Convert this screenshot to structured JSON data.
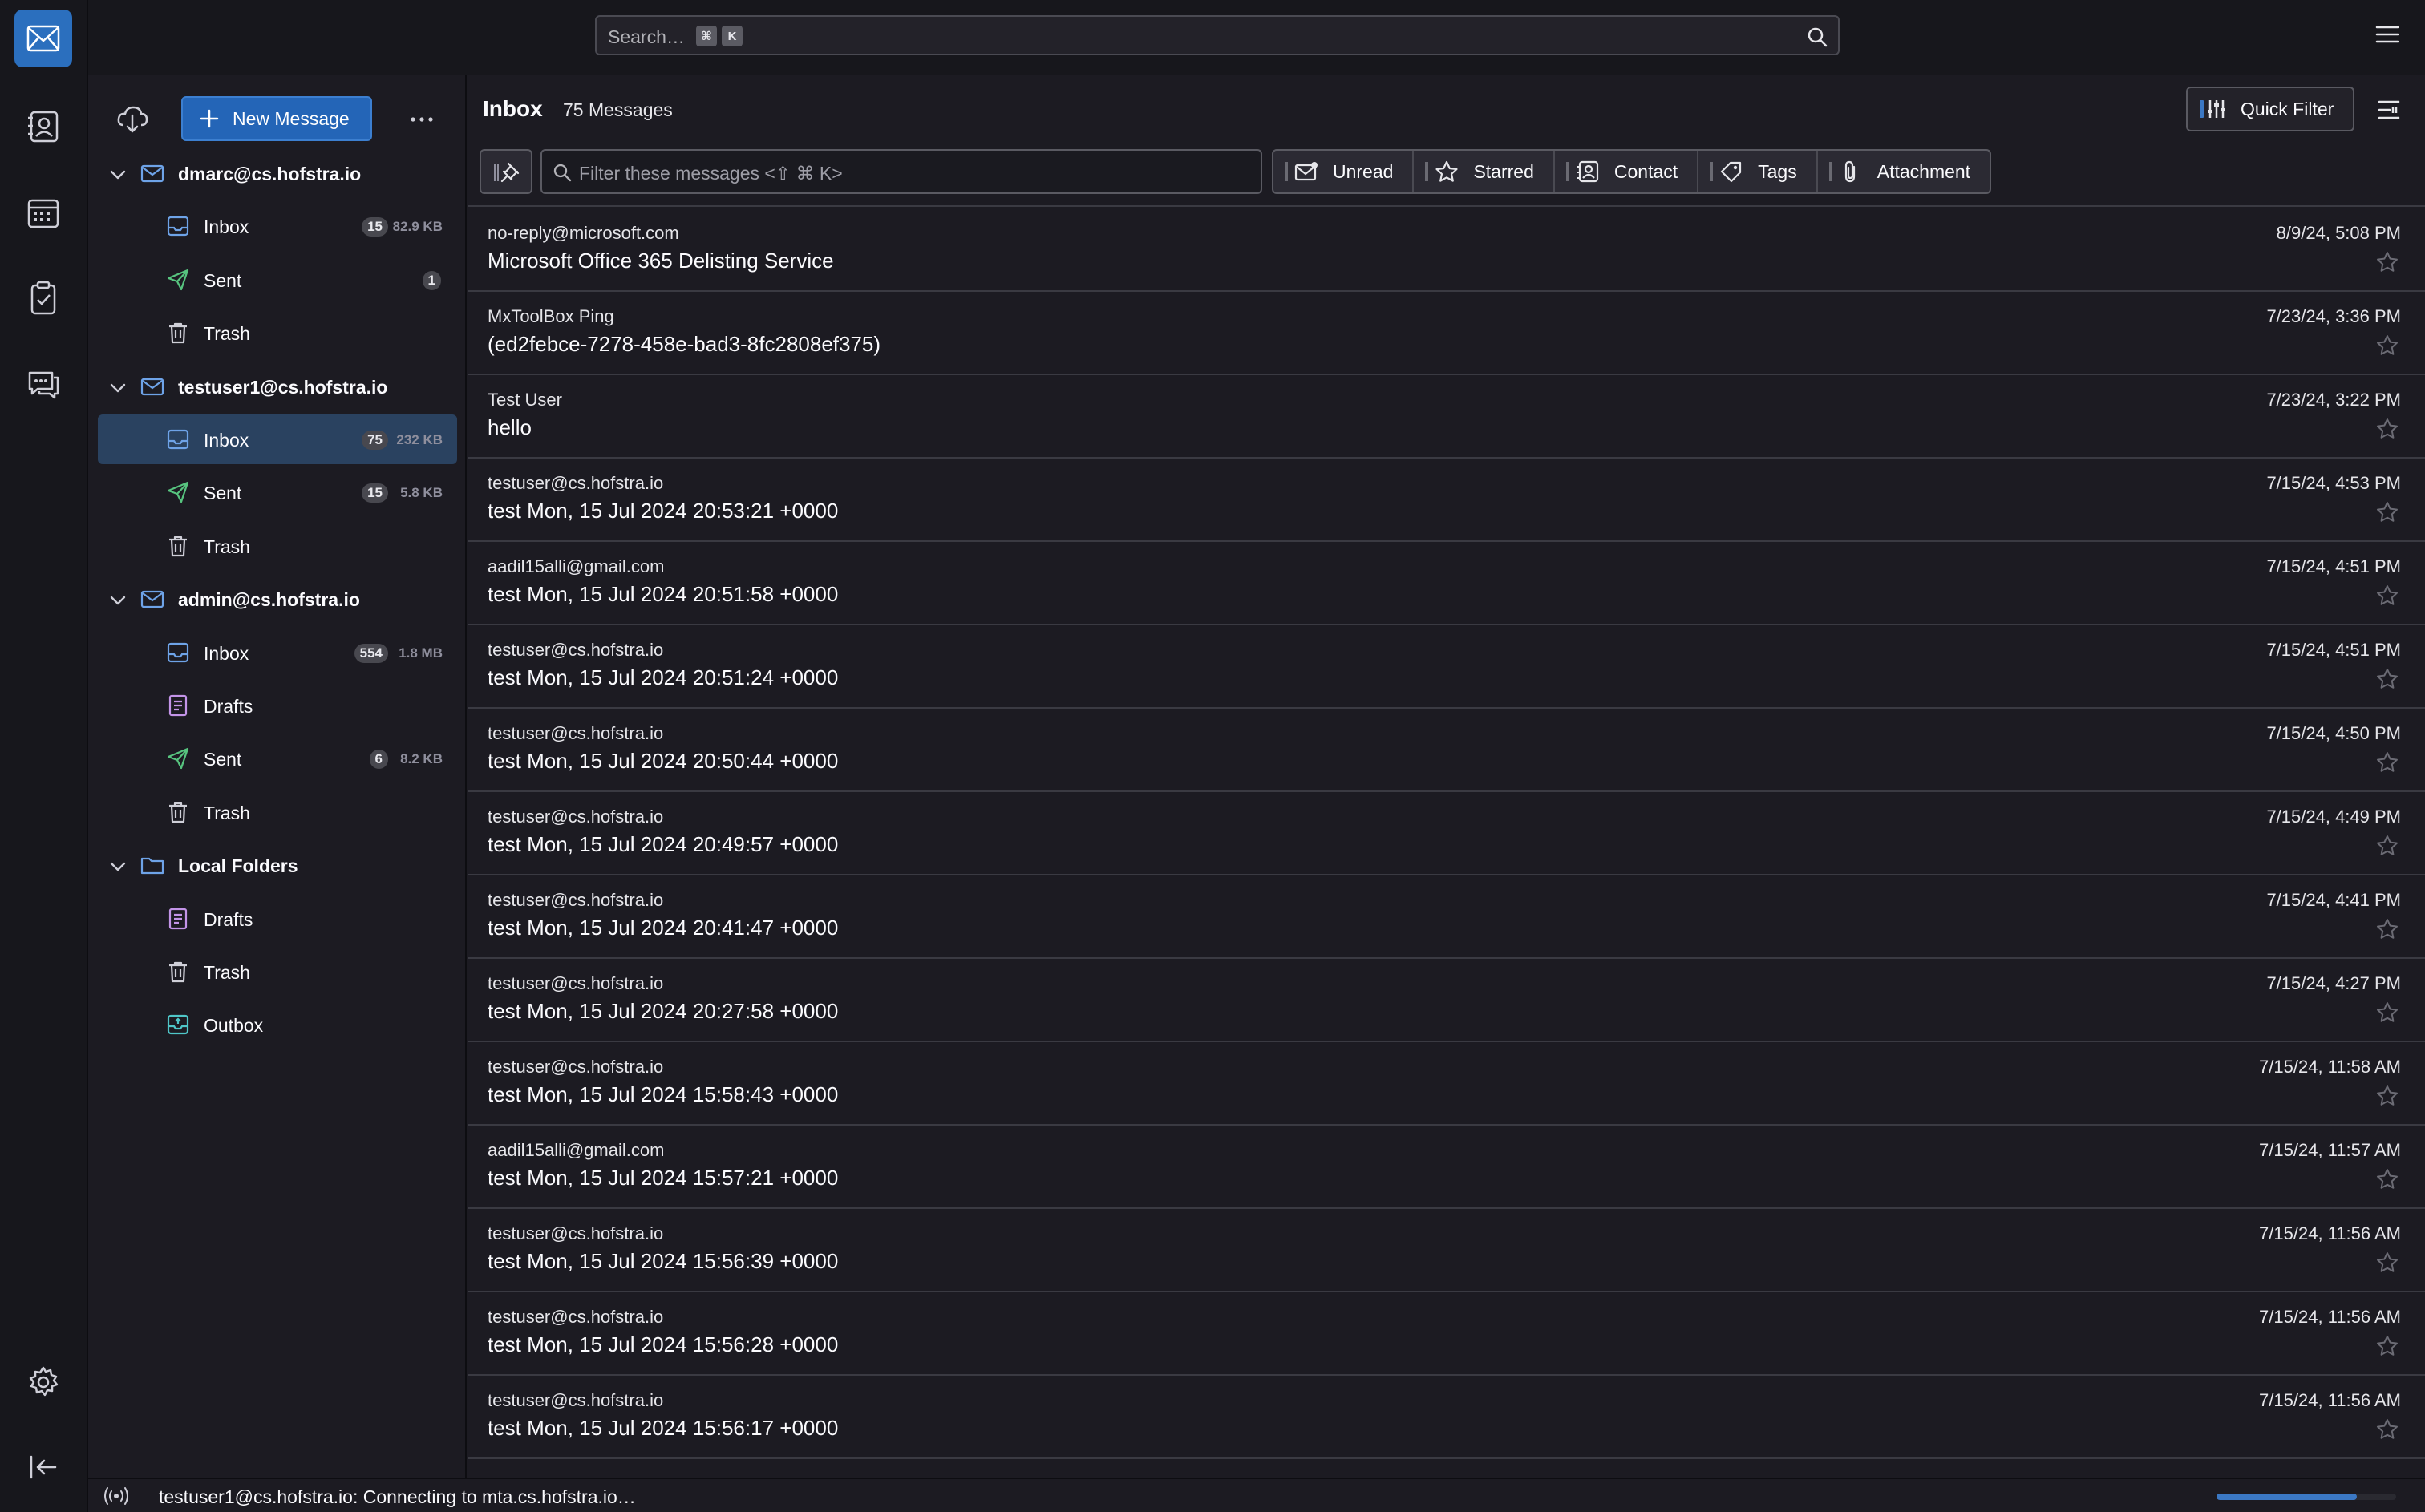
{
  "search": {
    "placeholder": "Search…",
    "shortcut_keys": [
      "⌘",
      "K"
    ]
  },
  "spaces": {
    "items": [
      "mail-icon",
      "address-book-icon",
      "calendar-icon",
      "tasks-icon",
      "chat-icon"
    ],
    "bottom": [
      "settings-icon",
      "collapse-icon"
    ]
  },
  "folder_pane": {
    "new_message_label": "New Message",
    "accounts": [
      {
        "label": "dmarc@cs.hofstra.io",
        "folders": [
          {
            "label": "Inbox",
            "badge": "15",
            "size": "82.9 KB",
            "icon": "inbox-icon"
          },
          {
            "label": "Sent",
            "badge": "1",
            "size": "",
            "icon": "sent-icon"
          },
          {
            "label": "Trash",
            "badge": "",
            "size": "",
            "icon": "trash-icon"
          }
        ]
      },
      {
        "label": "testuser1@cs.hofstra.io",
        "folders": [
          {
            "label": "Inbox",
            "badge": "75",
            "size": "232 KB",
            "icon": "inbox-icon",
            "selected": true
          },
          {
            "label": "Sent",
            "badge": "15",
            "size": "5.8 KB",
            "icon": "sent-icon"
          },
          {
            "label": "Trash",
            "badge": "",
            "size": "",
            "icon": "trash-icon"
          }
        ]
      },
      {
        "label": "admin@cs.hofstra.io",
        "folders": [
          {
            "label": "Inbox",
            "badge": "554",
            "size": "1.8 MB",
            "icon": "inbox-icon"
          },
          {
            "label": "Drafts",
            "badge": "",
            "size": "",
            "icon": "drafts-icon"
          },
          {
            "label": "Sent",
            "badge": "6",
            "size": "8.2 KB",
            "icon": "sent-icon"
          },
          {
            "label": "Trash",
            "badge": "",
            "size": "",
            "icon": "trash-icon"
          }
        ]
      },
      {
        "label": "Local Folders",
        "folders": [
          {
            "label": "Drafts",
            "badge": "",
            "size": "",
            "icon": "drafts-icon"
          },
          {
            "label": "Trash",
            "badge": "",
            "size": "",
            "icon": "trash-icon"
          },
          {
            "label": "Outbox",
            "badge": "",
            "size": "",
            "icon": "outbox-icon"
          }
        ]
      }
    ]
  },
  "thread_pane": {
    "title": "Inbox",
    "count": "75 Messages",
    "quick_filter_label": "Quick Filter",
    "filter_placeholder": "Filter these messages <⇧ ⌘ K>",
    "filters": [
      "Unread",
      "Starred",
      "Contact",
      "Tags",
      "Attachment"
    ],
    "messages": [
      {
        "from": "no-reply@microsoft.com",
        "subject": "Microsoft Office 365 Delisting Service",
        "date": "8/9/24, 5:08 PM"
      },
      {
        "from": "MxToolBox Ping",
        "subject": "(ed2febce-7278-458e-bad3-8fc2808ef375)",
        "date": "7/23/24, 3:36 PM"
      },
      {
        "from": "Test User",
        "subject": "hello",
        "date": "7/23/24, 3:22 PM"
      },
      {
        "from": "testuser@cs.hofstra.io",
        "subject": "test Mon, 15 Jul 2024 20:53:21 +0000",
        "date": "7/15/24, 4:53 PM"
      },
      {
        "from": "aadil15alli@gmail.com",
        "subject": "test Mon, 15 Jul 2024 20:51:58 +0000",
        "date": "7/15/24, 4:51 PM"
      },
      {
        "from": "testuser@cs.hofstra.io",
        "subject": "test Mon, 15 Jul 2024 20:51:24 +0000",
        "date": "7/15/24, 4:51 PM"
      },
      {
        "from": "testuser@cs.hofstra.io",
        "subject": "test Mon, 15 Jul 2024 20:50:44 +0000",
        "date": "7/15/24, 4:50 PM"
      },
      {
        "from": "testuser@cs.hofstra.io",
        "subject": "test Mon, 15 Jul 2024 20:49:57 +0000",
        "date": "7/15/24, 4:49 PM"
      },
      {
        "from": "testuser@cs.hofstra.io",
        "subject": "test Mon, 15 Jul 2024 20:41:47 +0000",
        "date": "7/15/24, 4:41 PM"
      },
      {
        "from": "testuser@cs.hofstra.io",
        "subject": "test Mon, 15 Jul 2024 20:27:58 +0000",
        "date": "7/15/24, 4:27 PM"
      },
      {
        "from": "testuser@cs.hofstra.io",
        "subject": "test Mon, 15 Jul 2024 15:58:43 +0000",
        "date": "7/15/24, 11:58 AM"
      },
      {
        "from": "aadil15alli@gmail.com",
        "subject": "test Mon, 15 Jul 2024 15:57:21 +0000",
        "date": "7/15/24, 11:57 AM"
      },
      {
        "from": "testuser@cs.hofstra.io",
        "subject": "test Mon, 15 Jul 2024 15:56:39 +0000",
        "date": "7/15/24, 11:56 AM"
      },
      {
        "from": "testuser@cs.hofstra.io",
        "subject": "test Mon, 15 Jul 2024 15:56:28 +0000",
        "date": "7/15/24, 11:56 AM"
      },
      {
        "from": "testuser@cs.hofstra.io",
        "subject": "test Mon, 15 Jul 2024 15:56:17 +0000",
        "date": "7/15/24, 11:56 AM"
      }
    ]
  },
  "status_bar": {
    "text": "testuser1@cs.hofstra.io: Connecting to mta.cs.hofstra.io…",
    "progress": 0.78
  },
  "colors": {
    "accent": "#2465b7",
    "selected_row": "#2a4260",
    "background": "#1c1b22"
  }
}
